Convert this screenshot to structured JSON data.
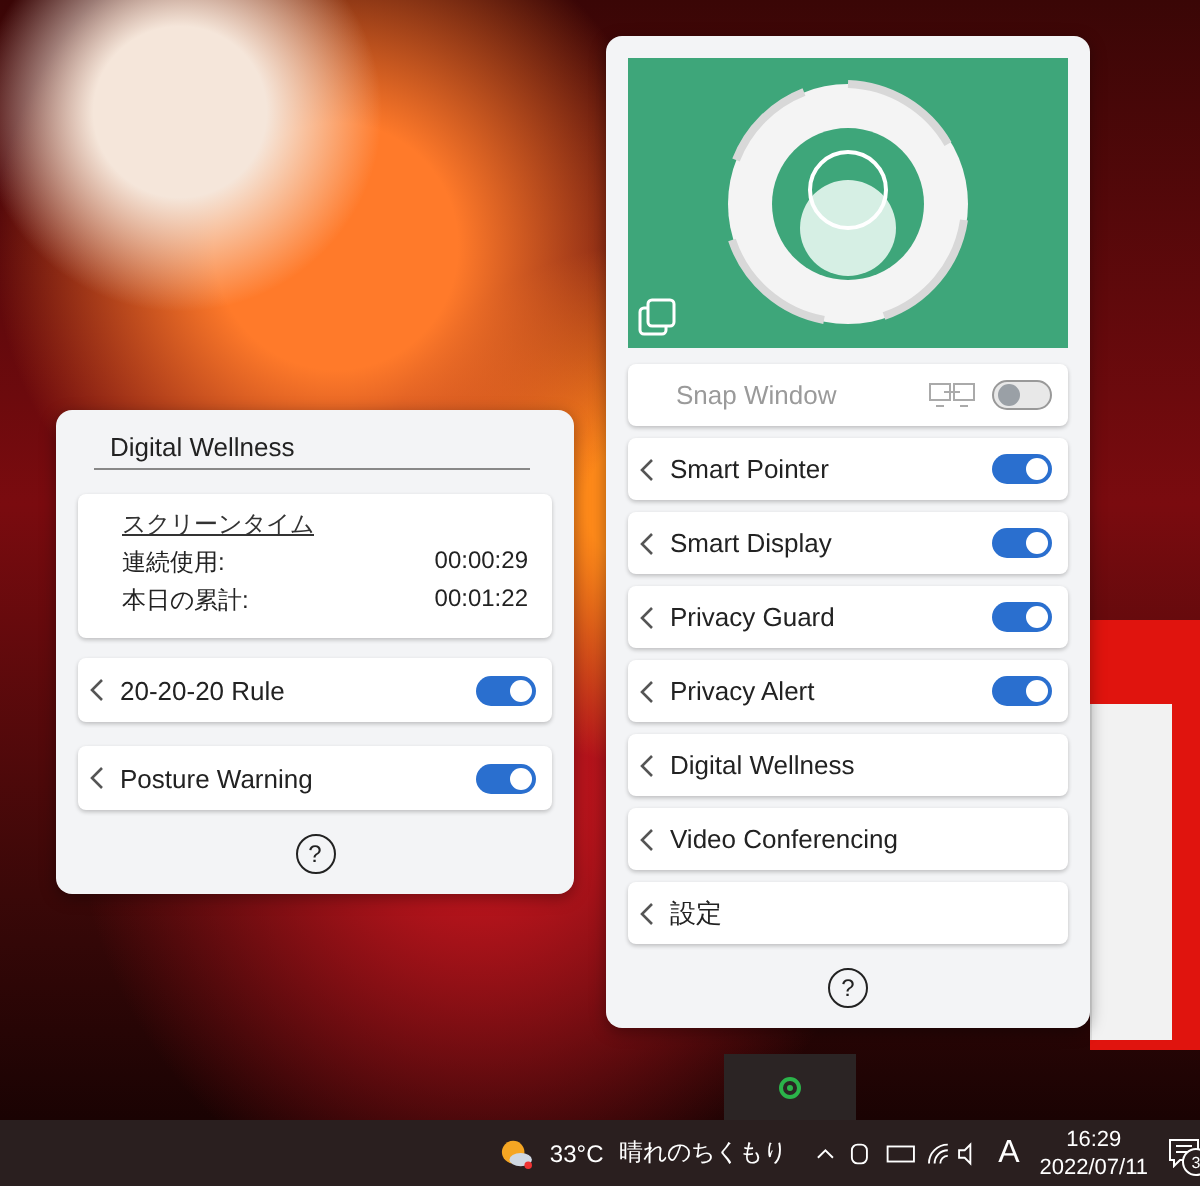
{
  "main_panel": {
    "items": [
      {
        "kind": "snap",
        "label": "Snap Window",
        "on": false,
        "disabled": true
      },
      {
        "kind": "toggle",
        "label": "Smart Pointer",
        "on": true
      },
      {
        "kind": "toggle",
        "label": "Smart Display",
        "on": true
      },
      {
        "kind": "toggle",
        "label": "Privacy Guard",
        "on": true
      },
      {
        "kind": "toggle",
        "label": "Privacy Alert",
        "on": true
      },
      {
        "kind": "link",
        "label": "Digital Wellness"
      },
      {
        "kind": "link",
        "label": "Video Conferencing"
      },
      {
        "kind": "link",
        "label": "設定"
      }
    ],
    "help": "?"
  },
  "wellness_panel": {
    "title": "Digital Wellness",
    "screen_time": {
      "heading": "スクリーンタイム",
      "rows": [
        {
          "label": "連続使用:",
          "value": "00:00:29"
        },
        {
          "label": "本日の累計:",
          "value": "00:01:22"
        }
      ]
    },
    "items": [
      {
        "label": "20-20-20 Rule",
        "on": true
      },
      {
        "label": "Posture Warning",
        "on": true
      }
    ],
    "help": "?"
  },
  "taskbar": {
    "temperature": "33°C",
    "weather": "晴れのちくもり",
    "ime": "A",
    "time": "16:29",
    "date": "2022/07/11",
    "notification_count": "3"
  }
}
